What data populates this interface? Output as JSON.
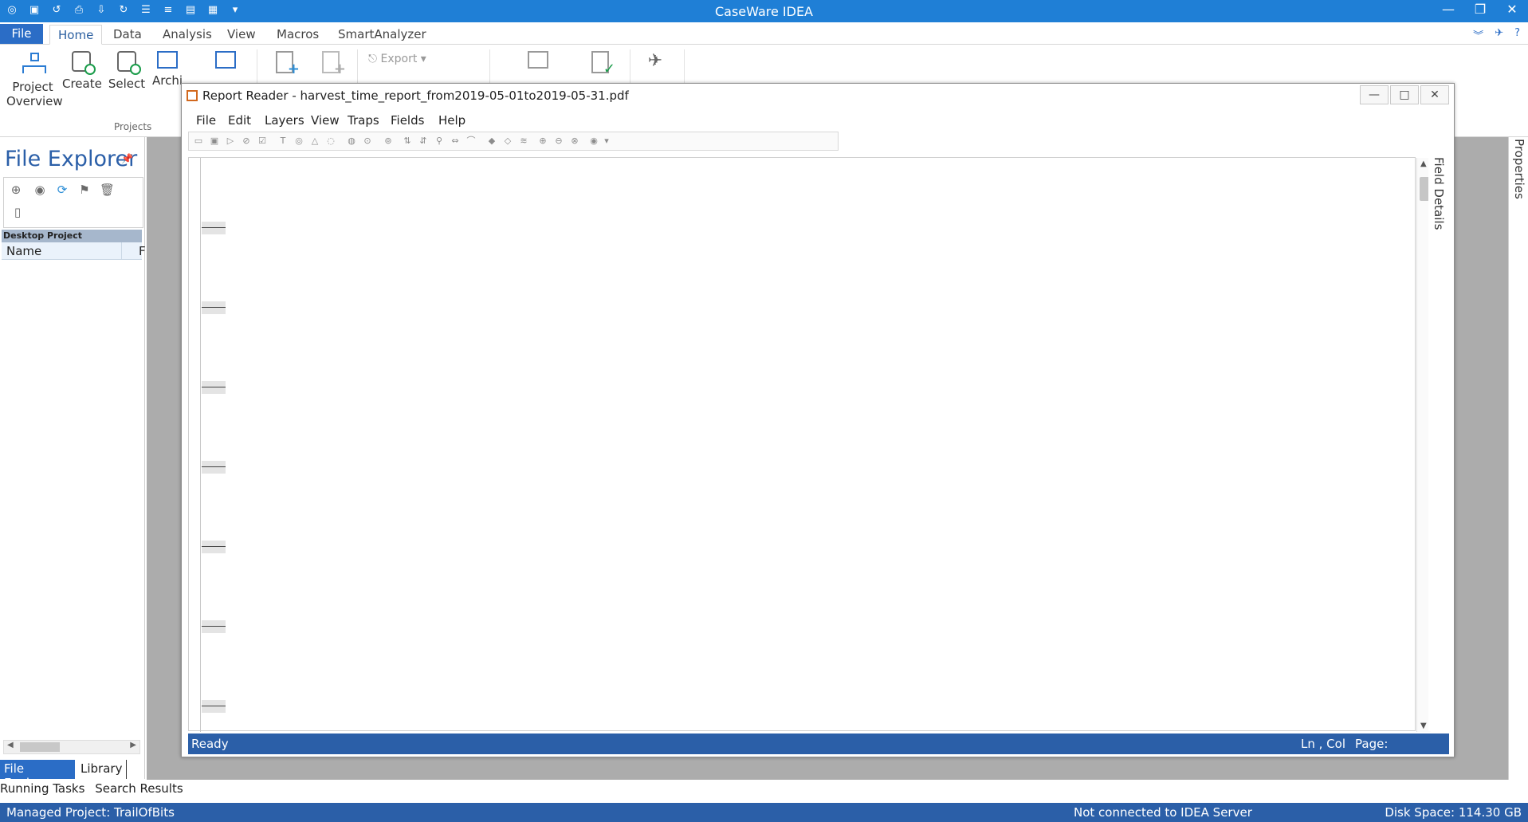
{
  "app": {
    "title": "CaseWare IDEA"
  },
  "ribbon_tabs": [
    "File",
    "Home",
    "Data",
    "Analysis",
    "View",
    "Macros",
    "SmartAnalyzer"
  ],
  "ribbon": {
    "project_overview_1": "Project",
    "project_overview_2": "Overview",
    "create": "Create",
    "select": "Select",
    "archive": "Archi",
    "export": "Export",
    "group_projects": "Projects"
  },
  "file_explorer": {
    "title": "File Explorer",
    "project_label": "Desktop Project",
    "col_name": "Name",
    "col_f": "F"
  },
  "bottom_tabs": {
    "file_explorer": "File Explorer",
    "library": "Library"
  },
  "sub_tabs": {
    "running": "Running Tasks",
    "search": "Search Results"
  },
  "report_reader": {
    "title": "Report Reader - harvest_time_report_from2019-05-01to2019-05-31.pdf",
    "menu": [
      "File",
      "Edit",
      "Layers",
      "View",
      "Traps",
      "Fields",
      "Help"
    ],
    "field_details": "Field Details",
    "status_ready": "Ready",
    "status_lncol": "Ln , Col",
    "status_page": "Page:"
  },
  "properties_label": "Properties",
  "statusbar": {
    "managed_project": "Managed Project: TrailOfBits",
    "server": "Not connected to IDEA Server",
    "disk": "Disk Space: 114.30 GB"
  },
  "colors": {
    "accent": "#2b6dc6",
    "titlebar": "#1f7fd6",
    "workspace": "#acacac"
  }
}
